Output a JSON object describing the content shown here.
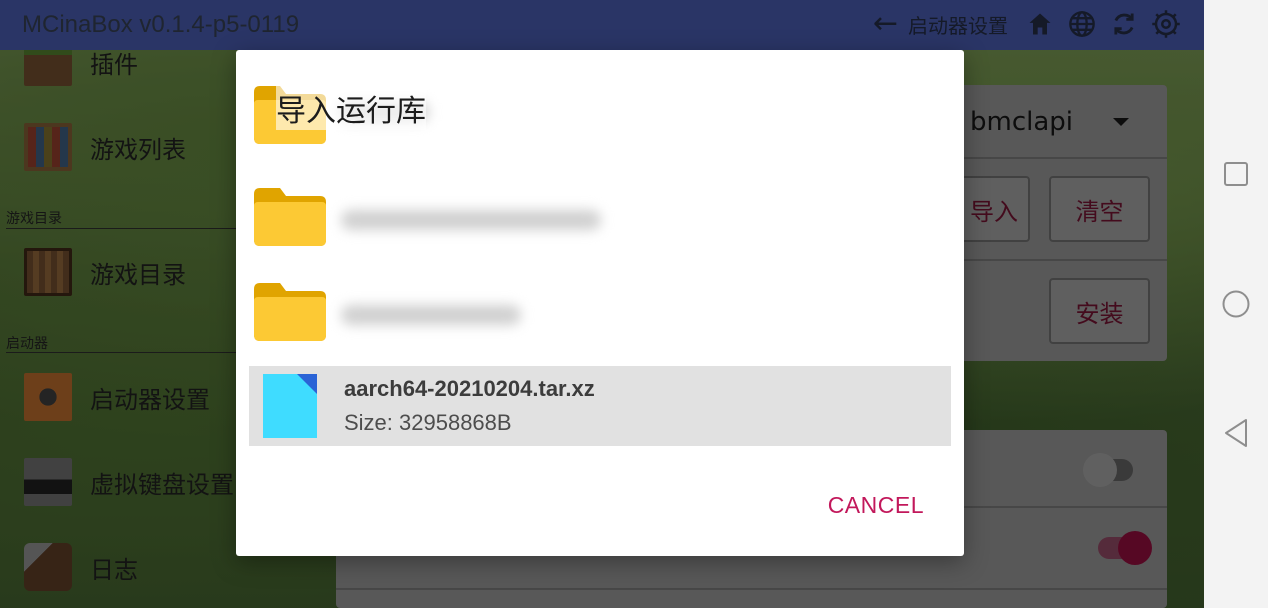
{
  "app": {
    "title": "MCinaBox v0.1.4-p5-0119"
  },
  "topbar": {
    "back_icon": "arrow-left-icon",
    "current_page": "启动器设置",
    "icons": [
      "home-icon",
      "globe-icon",
      "refresh-icon",
      "settings-icon"
    ]
  },
  "sidebar": {
    "items": [
      {
        "label": "插件",
        "icon": "plugin-block-icon"
      },
      {
        "label": "游戏列表",
        "icon": "bookshelf-block-icon"
      },
      {
        "label": "游戏目录",
        "icon": "chest-block-icon"
      },
      {
        "label": "启动器设置",
        "icon": "command-block-icon"
      },
      {
        "label": "虚拟键盘设置",
        "icon": "furnace-block-icon"
      },
      {
        "label": "日志",
        "icon": "book-quill-icon"
      }
    ],
    "sections": {
      "game_dir": "游戏目录",
      "launcher": "启动器"
    }
  },
  "settings_panel": {
    "mirror_value": "bmclapi",
    "import_label": "导入",
    "clear_label": "清空",
    "install_label": "安装",
    "toggle_off": "off",
    "toggle_on": "on"
  },
  "dialog": {
    "title": "导入运行库",
    "files": [
      {
        "type": "folder",
        "name": ""
      },
      {
        "type": "folder",
        "name": ""
      },
      {
        "type": "folder",
        "name": ""
      },
      {
        "type": "file",
        "name": "aarch64-20210204.tar.xz",
        "size": "Size: 32958868B",
        "selected": true
      }
    ],
    "cancel_label": "CANCEL"
  },
  "navbar": {
    "icons": [
      "recent-apps-icon",
      "home-circle-icon",
      "back-triangle-icon"
    ]
  },
  "colors": {
    "accent": "#c2185b",
    "topbar": "#2a3566",
    "folder": "#fcc934",
    "file": "#3fdcff"
  }
}
